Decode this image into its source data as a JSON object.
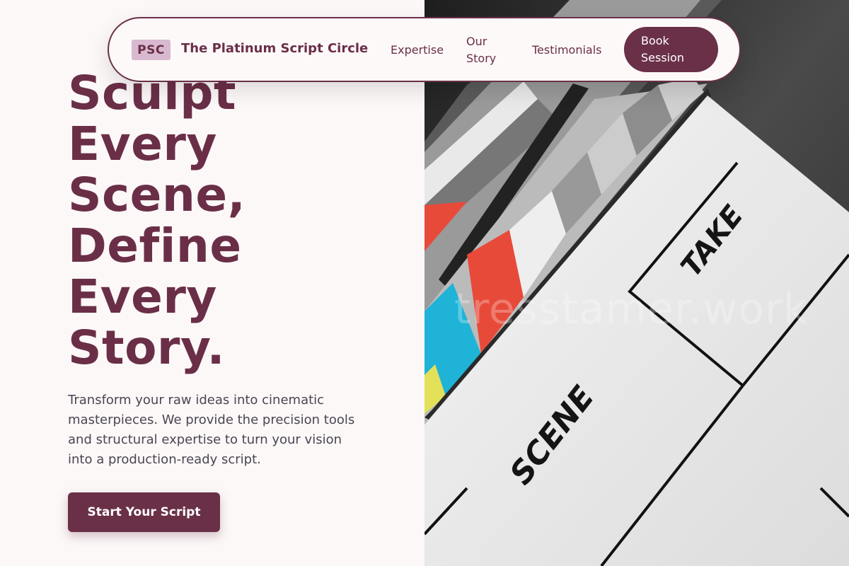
{
  "nav": {
    "logo_badge": "PSC",
    "brand_name": "The Platinum Script Circle",
    "links": [
      "Expertise",
      "Our Story",
      "Testimonials"
    ],
    "cta_label": "Book Session"
  },
  "hero": {
    "title_lines": [
      "Sculpt",
      "Every",
      "Scene,",
      "Define",
      "Every",
      "Story."
    ],
    "description": "Transform your raw ideas into cinematic masterpieces. We provide the precision tools and structural expertise to turn your vision into a production-ready script.",
    "cta_label": "Start Your Script"
  },
  "image": {
    "subject": "clapperboard",
    "board_labels": [
      "TAKE",
      "SCENE"
    ],
    "watermark": "tresstamer.work"
  },
  "colors": {
    "brand": "#6a3048",
    "badge_bg": "#d8b9cf",
    "page_bg": "#fcf8f8"
  }
}
